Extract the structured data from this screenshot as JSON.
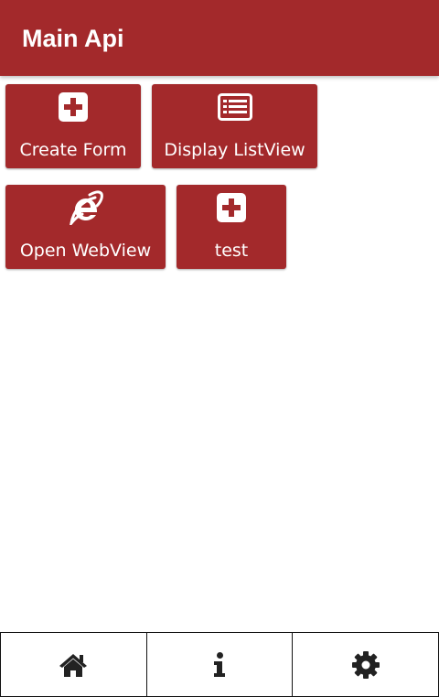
{
  "app_bar": {
    "title": "Main Api",
    "color": "#a3292b"
  },
  "tiles": [
    {
      "label": "Create Form",
      "icon": "plus-square-icon"
    },
    {
      "label": "Display ListView",
      "icon": "list-alt-icon"
    },
    {
      "label": "Open WebView",
      "icon": "internet-explorer-icon"
    },
    {
      "label": "test",
      "icon": "plus-square-icon"
    }
  ],
  "bottom_nav": [
    {
      "icon": "home-icon"
    },
    {
      "icon": "info-icon"
    },
    {
      "icon": "gear-icon"
    }
  ]
}
